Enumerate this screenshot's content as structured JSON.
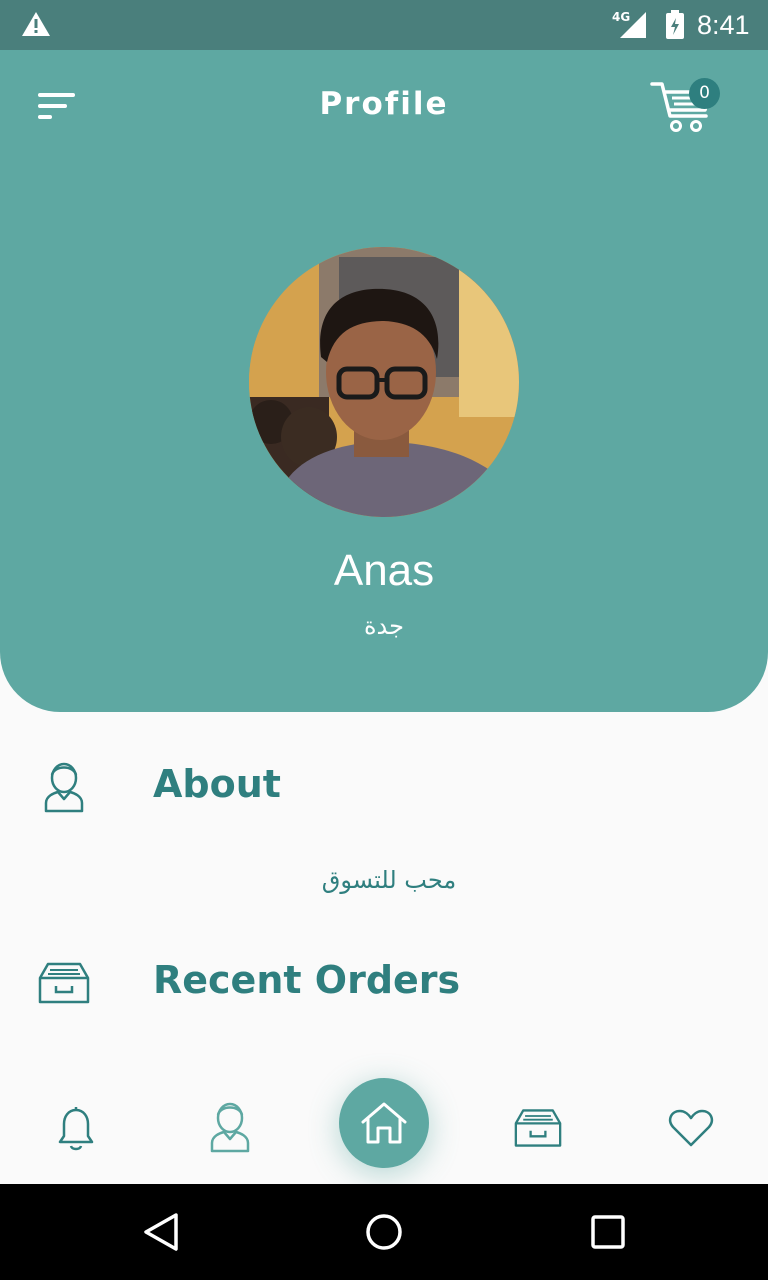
{
  "status_bar": {
    "network": "4G",
    "time": "8:41"
  },
  "header": {
    "title": "Profile",
    "cart_count": "0"
  },
  "profile": {
    "name": "Anas",
    "city": "جدة"
  },
  "sections": {
    "about": {
      "title": "About",
      "text": "محب للتسوق"
    },
    "recent_orders": {
      "title": "Recent Orders"
    }
  },
  "colors": {
    "primary": "#5ea8a2",
    "accent_text": "#2f7f7f",
    "status_bar": "#4a7f7c"
  },
  "icons": {
    "menu": "menu-icon",
    "cart": "cart-icon",
    "about": "user-icon",
    "orders": "inbox-icon",
    "nav": [
      "bell-icon",
      "user-icon",
      "home-icon",
      "inbox-icon",
      "heart-icon"
    ]
  }
}
